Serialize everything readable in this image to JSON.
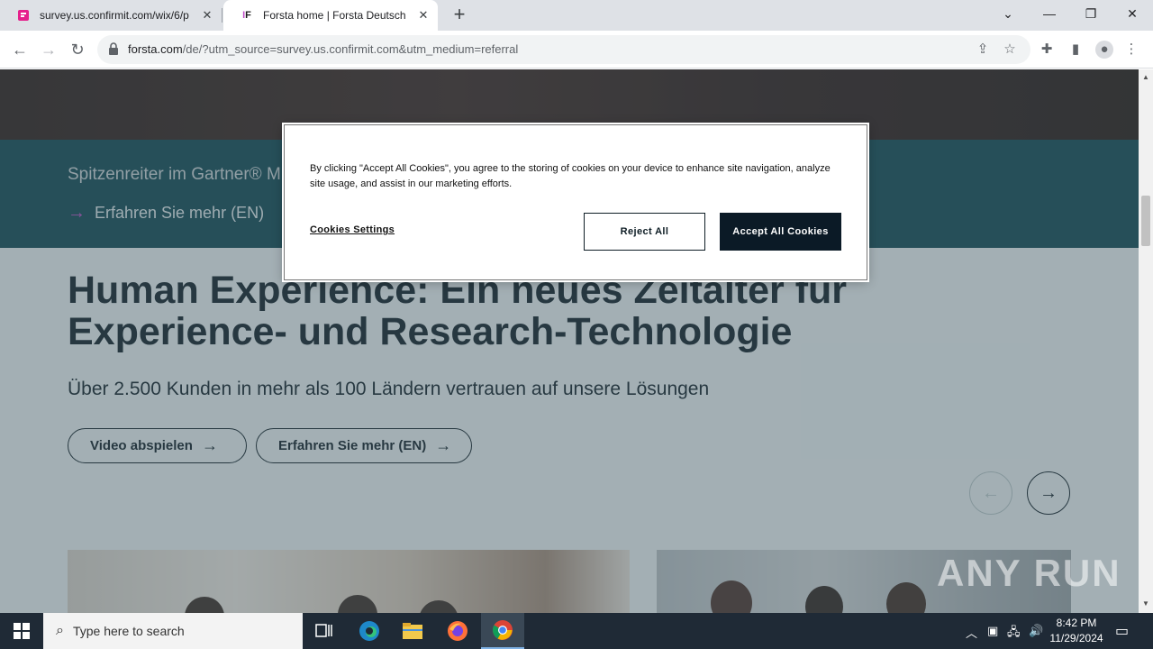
{
  "browser": {
    "tabs": [
      {
        "title": "survey.us.confirmit.com/wix/6/p",
        "active": false
      },
      {
        "title": "Forsta home | Forsta Deutsch",
        "active": true
      }
    ],
    "url_host": "forsta.com",
    "url_rest": "/de/?utm_source=survey.us.confirmit.com&utm_medium=referral"
  },
  "page": {
    "gartner_text": "Spitzenreiter im Gartner® M",
    "gartner_link": "Erfahren Sie mehr (EN)",
    "headline_line1": "Human Experience: Ein neues Zeitalter für",
    "headline_line2": "Experience- und Research-Technologie",
    "subline": "Über 2.500 Kunden in mehr als 100 Ländern vertrauen auf unsere Lösungen",
    "btn_video": "Video abspielen",
    "btn_more": "Erfahren Sie mehr (EN)"
  },
  "cookie": {
    "text": "By clicking \"Accept All Cookies\", you agree to the storing of cookies on your device to enhance site navigation, analyze site usage, and assist in our marketing efforts.",
    "settings": "Cookies Settings",
    "reject": "Reject All",
    "accept": "Accept All Cookies"
  },
  "watermark": "ANY RUN",
  "taskbar": {
    "search_placeholder": "Type here to search",
    "time": "8:42 PM",
    "date": "11/29/2024"
  }
}
